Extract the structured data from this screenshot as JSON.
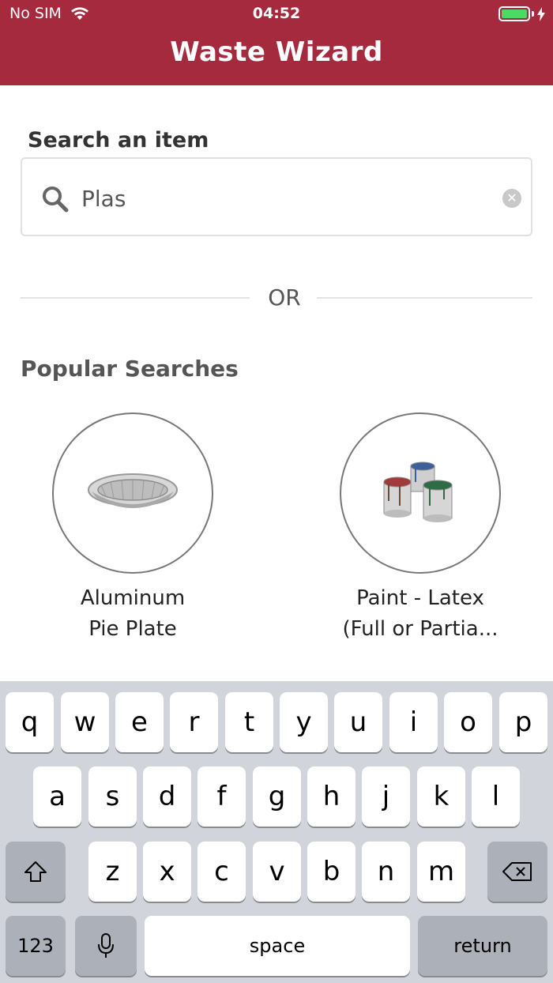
{
  "status_bar": {
    "carrier": "No SIM",
    "time": "04:52"
  },
  "header": {
    "title": "Waste Wizard"
  },
  "search": {
    "label": "Search an item",
    "value": "Plas"
  },
  "divider": {
    "text": "OR"
  },
  "popular": {
    "title": "Popular Searches",
    "items": [
      {
        "line1": "Aluminum",
        "line2": "Pie Plate"
      },
      {
        "line1": "Paint - Latex",
        "line2": "(Full or Partia..."
      }
    ]
  },
  "keyboard": {
    "row1": [
      "q",
      "w",
      "e",
      "r",
      "t",
      "y",
      "u",
      "i",
      "o",
      "p"
    ],
    "row2": [
      "a",
      "s",
      "d",
      "f",
      "g",
      "h",
      "j",
      "k",
      "l"
    ],
    "row3": [
      "z",
      "x",
      "c",
      "v",
      "b",
      "n",
      "m"
    ],
    "numbers_label": "123",
    "space_label": "space",
    "return_label": "return"
  },
  "colors": {
    "header": "#a52a3e",
    "battery": "#4cd964",
    "keyboard_bg": "#d1d4da"
  }
}
